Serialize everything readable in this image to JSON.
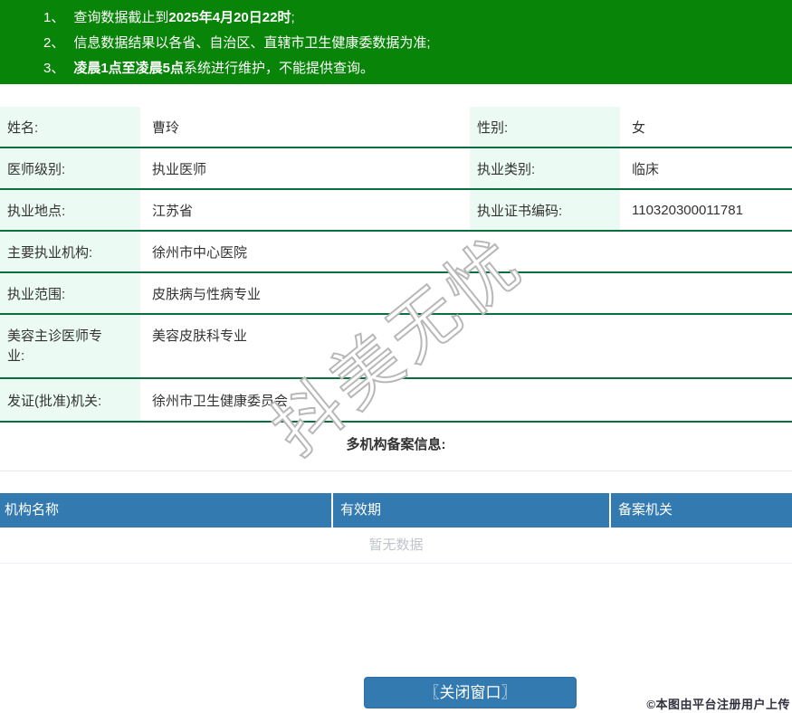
{
  "colors": {
    "banner_green": "#088408",
    "table_border_green": "#0a6e40",
    "label_cell_green": "#ebfaf2",
    "header_blue": "#337ab0",
    "empty_text_grey": "#c0c4cc"
  },
  "banner": {
    "notices": [
      {
        "num": "1、",
        "pre": "查询数据截止到",
        "bold": "2025年4月20日22时",
        "post": ";"
      },
      {
        "num": "2、",
        "pre": "信息数据结果以各省、自治区、直辖市卫生健康委数据为准;",
        "bold": "",
        "post": ""
      },
      {
        "num": "3、",
        "pre": "",
        "bold": "凌晨1点至凌晨5点",
        "post": "系统进行维护，不能提供查询。"
      }
    ]
  },
  "info": {
    "rows2col": [
      {
        "label1": "姓名:",
        "value1": "曹玲",
        "label2": "性别:",
        "value2": "女"
      },
      {
        "label1": "医师级别:",
        "value1": "执业医师",
        "label2": "执业类别:",
        "value2": "临床"
      },
      {
        "label1": "执业地点:",
        "value1": "江苏省",
        "label2": "执业证书编码:",
        "value2": "110320300011781"
      }
    ],
    "rows1col": [
      {
        "label": "主要执业机构:",
        "value": "徐州市中心医院"
      },
      {
        "label": "执业范围:",
        "value": "皮肤病与性病专业"
      },
      {
        "label": "美容主诊医师专业:",
        "value": "美容皮肤科专业"
      },
      {
        "label": "发证(批准)机关:",
        "value": "徐州市卫生健康委员会"
      }
    ]
  },
  "section": {
    "title": "多机构备案信息:"
  },
  "record_table": {
    "headers": [
      "机构名称",
      "有效期",
      "备案机关"
    ],
    "empty_text": "暂无数据"
  },
  "footer": {
    "close_button": "〖关闭窗口〗",
    "copyright": "©本图由平台注册用户上传"
  },
  "watermark": {
    "text": "抖美无忧"
  }
}
